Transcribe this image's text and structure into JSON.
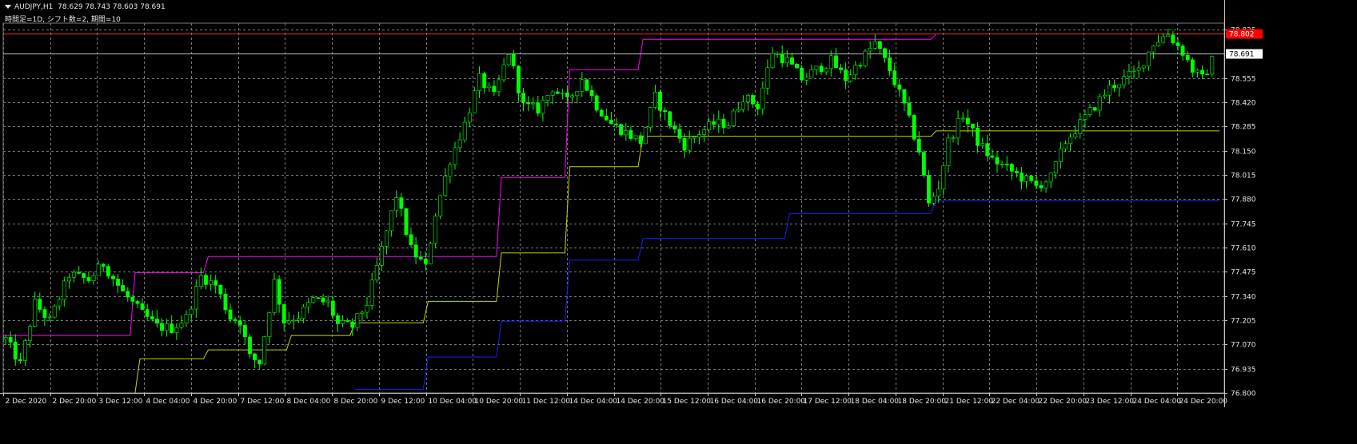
{
  "header": {
    "symbol": "AUDJPY,H1",
    "ohlc": "78.629 78.743 78.603 78.691",
    "indicator": "時間足=1D, シフト数=2, 期間=10"
  },
  "colors": {
    "background": "#000000",
    "grid": "#7a7a7a",
    "candle": "#00ff00",
    "price_line": "#c0c0c0",
    "last_label_bg": "#ffffff",
    "red_label_bg": "#ff0000",
    "red_line": "#ff2a2a",
    "magenta": "#ff00ff",
    "yellow": "#c8d400",
    "blue": "#1c1cff"
  },
  "price_axis": {
    "labels": [
      "78.825",
      "78.555",
      "78.420",
      "78.285",
      "78.150",
      "78.015",
      "77.880",
      "77.745",
      "77.610",
      "77.475",
      "77.340",
      "77.205",
      "77.070",
      "76.935",
      "76.800"
    ],
    "current_price": "78.691",
    "red_price": "78.802"
  },
  "time_axis": {
    "labels": [
      "2 Dec 2020",
      "2 Dec 20:00",
      "3 Dec 12:00",
      "4 Dec 04:00",
      "4 Dec 20:00",
      "7 Dec 12:00",
      "8 Dec 04:00",
      "8 Dec 20:00",
      "9 Dec 12:00",
      "10 Dec 04:00",
      "10 Dec 20:00",
      "11 Dec 12:00",
      "14 Dec 04:00",
      "14 Dec 20:00",
      "15 Dec 12:00",
      "16 Dec 04:00",
      "16 Dec 20:00",
      "17 Dec 12:00",
      "18 Dec 04:00",
      "18 Dec 20:00",
      "21 Dec 12:00",
      "22 Dec 04:00",
      "22 Dec 20:00",
      "23 Dec 12:00",
      "24 Dec 04:00",
      "24 Dec 20:00"
    ]
  },
  "chart_data": {
    "type": "line",
    "title": "AUDJPY,H1",
    "ylim": [
      76.8,
      78.86
    ],
    "grid": true,
    "bars": 150,
    "price_path": [
      [
        0,
        77.1
      ],
      [
        3,
        76.96
      ],
      [
        6,
        77.3
      ],
      [
        9,
        77.2
      ],
      [
        13,
        77.46
      ],
      [
        17,
        77.43
      ],
      [
        20,
        77.52
      ],
      [
        24,
        77.36
      ],
      [
        28,
        77.24
      ],
      [
        31,
        77.17
      ],
      [
        34,
        77.16
      ],
      [
        37,
        77.22
      ],
      [
        40,
        77.45
      ],
      [
        43,
        77.4
      ],
      [
        46,
        77.22
      ],
      [
        48,
        77.2
      ],
      [
        50,
        77.0
      ],
      [
        52,
        76.97
      ],
      [
        55,
        77.42
      ],
      [
        57,
        77.2
      ],
      [
        60,
        77.23
      ],
      [
        63,
        77.32
      ],
      [
        66,
        77.3
      ],
      [
        68,
        77.18
      ],
      [
        71,
        77.17
      ],
      [
        74,
        77.3
      ],
      [
        77,
        77.6
      ],
      [
        80,
        77.9
      ],
      [
        83,
        77.6
      ],
      [
        86,
        77.5
      ],
      [
        88,
        77.8
      ],
      [
        91,
        78.1
      ],
      [
        94,
        78.3
      ],
      [
        97,
        78.55
      ],
      [
        100,
        78.45
      ],
      [
        103,
        78.7
      ],
      [
        106,
        78.4
      ],
      [
        109,
        78.38
      ],
      [
        112,
        78.5
      ],
      [
        115,
        78.42
      ],
      [
        118,
        78.55
      ],
      [
        121,
        78.4
      ],
      [
        124,
        78.3
      ],
      [
        127,
        78.25
      ],
      [
        130,
        78.2
      ],
      [
        133,
        78.45
      ],
      [
        136,
        78.3
      ],
      [
        139,
        78.18
      ],
      [
        142,
        78.25
      ],
      [
        145,
        78.3
      ],
      [
        148,
        78.3
      ],
      [
        151,
        78.45
      ],
      [
        154,
        78.4
      ],
      [
        157,
        78.7
      ],
      [
        160,
        78.65
      ],
      [
        163,
        78.55
      ],
      [
        166,
        78.6
      ],
      [
        169,
        78.65
      ],
      [
        172,
        78.55
      ],
      [
        175,
        78.65
      ],
      [
        178,
        78.75
      ],
      [
        181,
        78.6
      ],
      [
        184,
        78.4
      ],
      [
        187,
        78.15
      ],
      [
        189,
        77.85
      ],
      [
        191,
        77.95
      ],
      [
        193,
        78.2
      ],
      [
        196,
        78.35
      ],
      [
        199,
        78.2
      ],
      [
        202,
        78.1
      ],
      [
        205,
        78.05
      ],
      [
        208,
        78.0
      ],
      [
        211,
        77.95
      ],
      [
        214,
        78.0
      ],
      [
        217,
        78.2
      ],
      [
        220,
        78.3
      ],
      [
        223,
        78.4
      ],
      [
        226,
        78.5
      ],
      [
        229,
        78.55
      ],
      [
        232,
        78.6
      ],
      [
        235,
        78.75
      ],
      [
        238,
        78.8
      ],
      [
        241,
        78.7
      ],
      [
        243,
        78.6
      ],
      [
        245,
        78.55
      ],
      [
        247,
        78.65
      ]
    ],
    "overlay_lines": [
      {
        "color": "magenta",
        "label_from": "",
        "steps": [
          [
            0,
            77.12
          ],
          [
            26,
            77.12
          ],
          [
            27,
            77.47
          ],
          [
            41,
            77.47
          ],
          [
            42,
            77.56
          ],
          [
            101,
            77.56
          ],
          [
            102,
            78.0
          ],
          [
            115,
            78.0
          ],
          [
            116,
            78.6
          ],
          [
            130,
            78.6
          ],
          [
            131,
            78.77
          ],
          [
            190,
            78.77
          ],
          [
            191,
            78.8
          ],
          [
            249,
            78.8
          ]
        ]
      },
      {
        "color": "yellow",
        "label_from": "",
        "steps": [
          [
            27,
            76.8
          ],
          [
            28,
            76.99
          ],
          [
            41,
            76.99
          ],
          [
            42,
            77.04
          ],
          [
            58,
            77.04
          ],
          [
            59,
            77.12
          ],
          [
            71,
            77.12
          ],
          [
            72,
            77.19
          ],
          [
            86,
            77.19
          ],
          [
            87,
            77.31
          ],
          [
            101,
            77.31
          ],
          [
            102,
            77.58
          ],
          [
            115,
            77.58
          ],
          [
            116,
            78.06
          ],
          [
            130,
            78.06
          ],
          [
            131,
            78.23
          ],
          [
            190,
            78.23
          ],
          [
            191,
            78.26
          ],
          [
            249,
            78.26
          ]
        ]
      },
      {
        "color": "blue",
        "label_from": "",
        "steps": [
          [
            72,
            76.82
          ],
          [
            86,
            76.82
          ],
          [
            87,
            77.0
          ],
          [
            101,
            77.0
          ],
          [
            102,
            77.2
          ],
          [
            115,
            77.2
          ],
          [
            116,
            77.54
          ],
          [
            130,
            77.54
          ],
          [
            131,
            77.66
          ],
          [
            160,
            77.66
          ],
          [
            161,
            77.8
          ],
          [
            190,
            77.8
          ],
          [
            191,
            77.87
          ],
          [
            249,
            77.87
          ]
        ]
      }
    ]
  }
}
